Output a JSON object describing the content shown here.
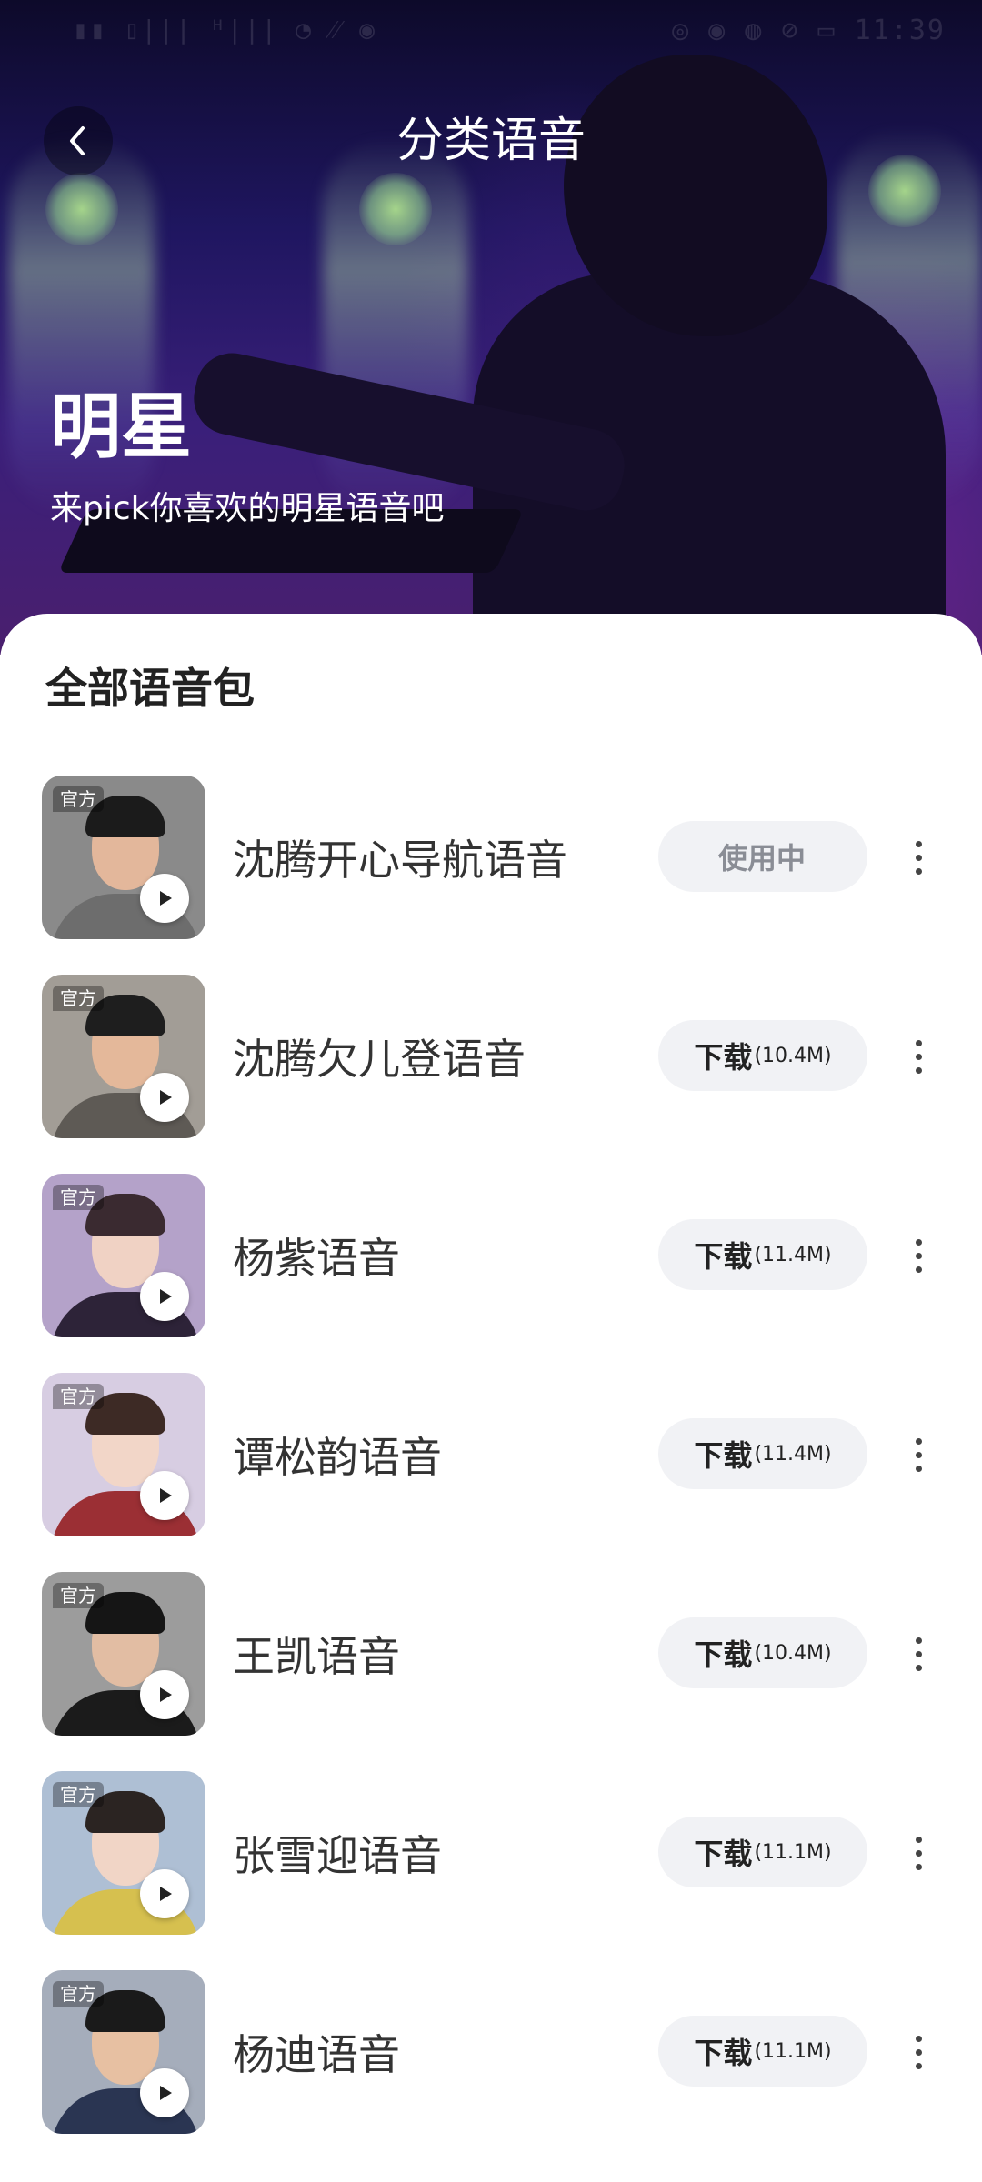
{
  "status_bar": {
    "left": "▮▮ ▯||| ᴴ|||  ◔ ⁄⁄ ◉",
    "right": "◎ ◉ ◍ ⊘ ▭ 11:39"
  },
  "header": {
    "title": "分类语音",
    "back_icon": "chevron-left-icon"
  },
  "hero": {
    "title": "明星",
    "subtitle": "来pick你喜欢的明星语音吧"
  },
  "section": {
    "title": "全部语音包"
  },
  "items": [
    {
      "tag": "官方",
      "name": "沈腾开心导航语音",
      "action": "使用中",
      "size": "",
      "in_use": true,
      "bg": "#8a8a8a",
      "skin": "#e3b79b",
      "hair": "#1b1b1b",
      "cloth": "#6d6d6d"
    },
    {
      "tag": "官方",
      "name": "沈腾欠儿登语音",
      "action": "下载",
      "size": "(10.4M)",
      "in_use": false,
      "bg": "#a29d96",
      "skin": "#e4b89a",
      "hair": "#1e1e1e",
      "cloth": "#5e5a55"
    },
    {
      "tag": "官方",
      "name": "杨紫语音",
      "action": "下载",
      "size": "(11.4M)",
      "in_use": false,
      "bg": "#b4a2c9",
      "skin": "#f0d2c4",
      "hair": "#3a2a30",
      "cloth": "#2d2338"
    },
    {
      "tag": "官方",
      "name": "谭松韵语音",
      "action": "下载",
      "size": "(11.4M)",
      "in_use": false,
      "bg": "#d7cde2",
      "skin": "#f2d6c8",
      "hair": "#3d2a25",
      "cloth": "#9b2f34"
    },
    {
      "tag": "官方",
      "name": "王凯语音",
      "action": "下载",
      "size": "(10.4M)",
      "in_use": false,
      "bg": "#9c9c9c",
      "skin": "#e2bda3",
      "hair": "#151515",
      "cloth": "#1b1b1b"
    },
    {
      "tag": "官方",
      "name": "张雪迎语音",
      "action": "下载",
      "size": "(11.1M)",
      "in_use": false,
      "bg": "#aebfd4",
      "skin": "#f1d5c6",
      "hair": "#2b2422",
      "cloth": "#d6c04f"
    },
    {
      "tag": "官方",
      "name": "杨迪语音",
      "action": "下载",
      "size": "(11.1M)",
      "in_use": false,
      "bg": "#a5adbb",
      "skin": "#e7c0a2",
      "hair": "#1a1a1a",
      "cloth": "#2a3552"
    }
  ]
}
